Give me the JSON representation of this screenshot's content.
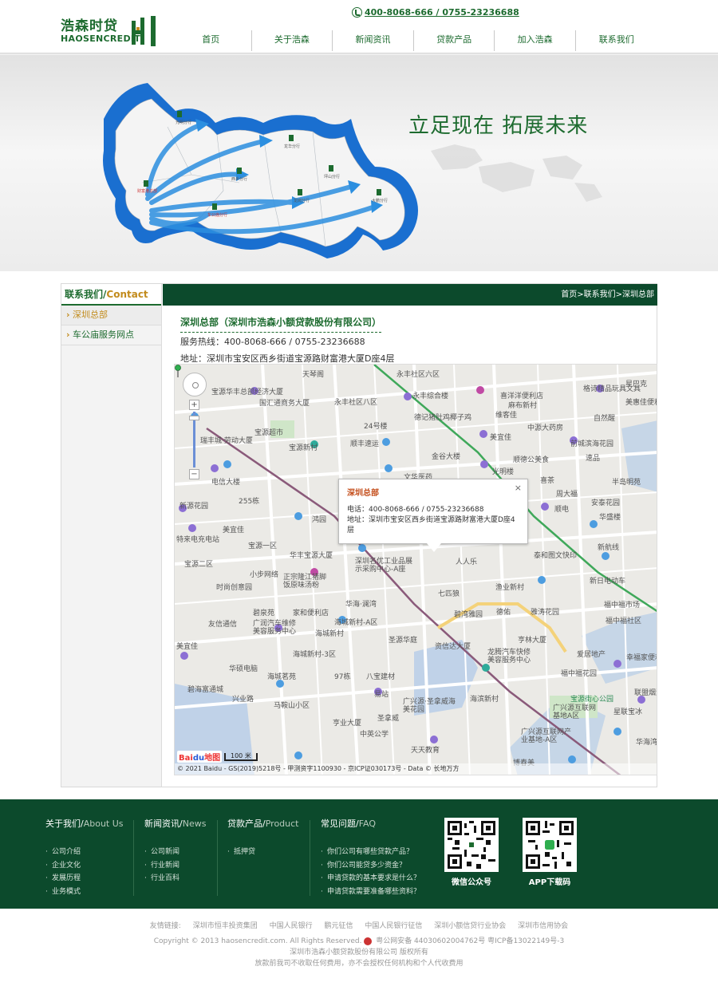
{
  "header": {
    "logo_cn": "浩森时贷",
    "logo_en": "HAOSENCREDIT",
    "hotline": "400-8068-666 / 0755-23236688",
    "nav": [
      "首页",
      "关于浩森",
      "新闻资讯",
      "贷款产品",
      "加入浩森",
      "联系我们"
    ]
  },
  "banner": {
    "slogan": "立足现在  拓展未来",
    "map_labels": [
      "财富港总部",
      "光明分行 筹备中",
      "龙华分行 筹备中",
      "龙岗分行",
      "西乡分行",
      "车公庙分行",
      "坪山分行 筹备中",
      "盐田分行 筹备中",
      "大鹏分行 筹备中"
    ]
  },
  "sidebar": {
    "title_cn": "联系我们/",
    "title_en": "Contact",
    "items": [
      "深圳总部",
      "车公庙服务网点"
    ]
  },
  "content": {
    "breadcrumb": "首页>联系我们>深圳总部",
    "office_title": "深圳总部（深圳市浩森小额贷款股份有限公司）",
    "hotline_line": "服务热线：400-8068-666 / 0755-23236688",
    "address_line": "地址：深圳市宝安区西乡街道宝源路财富港大厦D座4层"
  },
  "map": {
    "popup_title": "深圳总部",
    "popup_phone": "电话：400-8068-666 / 0755-23236688",
    "popup_address": "地址：深圳市宝安区西乡街道宝源路财富港大厦D座4层",
    "popup_close": "×",
    "zoom_in": "+",
    "zoom_out": "−",
    "scale": "100 米",
    "logo_bai": "Bai",
    "logo_du": "du",
    "logo_map": "地图",
    "copyright": "© 2021 Baidu - GS(2019)5218号 - 甲测资字1100930 - 京ICP证030173号 - Data © 长地万方",
    "labels": [
      "天琴阁",
      "宝源华丰总部经济大厦",
      "国汇通商务大厦",
      "永丰社区八区",
      "永丰社区六区",
      "永丰综合楼",
      "喜洋洋便利店",
      "格诗精品玩具文具",
      "星巴克",
      "美惠佳便利",
      "维客佳",
      "麻布新村",
      "德记猪肚鸡椰子鸡",
      "24号楼",
      "中源大药房",
      "自然醒",
      "宝源超市",
      "宝源新村",
      "顺丰速运",
      "美宜佳",
      "前城滨海花园",
      "瑞丰城·劳动大厦",
      "金谷大楼",
      "顺德公美食",
      "速品",
      "电信大楼",
      "文华医药",
      "光明楼",
      "喜茶",
      "半岛明苑",
      "新源花园",
      "255栋",
      "周大福",
      "安泰花园",
      "美宜佳",
      "鸿园",
      "顺电",
      "华盛楼",
      "特来电充电站",
      "宝源一区",
      "华丰宝源大厦",
      "深圳名优工业品展示采购中心-A座",
      "人人乐",
      "泰和图文快印",
      "新航线",
      "宝源二区",
      "小步网络",
      "正宗隆江猪脚饭原味汤粉",
      "七匹狼",
      "新日电动车",
      "时尚创意园",
      "华海·澜湾",
      "渔业新村",
      "碧泉苑",
      "家和便利店",
      "碧湾雅园",
      "德佑",
      "雅涛花园",
      "福中福市场",
      "友信通信",
      "广润汽车维修美容服务中心",
      "海城新村-A区",
      "海城新村",
      "圣源华庭",
      "福中福社区",
      "美宜佳",
      "资信达大厦",
      "亨林大厦",
      "海城新村-3区",
      "龙腾汽车快修美容服务中心",
      "爱居地产",
      "幸福家便利店",
      "华硕电脑",
      "海城茗苑",
      "八宝建材",
      "福中福花园",
      "碧海富通城",
      "97栋",
      "海滨新村",
      "易站",
      "宝源街心公园",
      "联盟烟酒",
      "马鞍山小区",
      "兴业路",
      "广兴源·圣拿威海美花园",
      "广兴源互联网基地A区",
      "星联宝冰",
      "亨业大厦",
      "圣拿威",
      "中英公学",
      "天天教育",
      "广兴源互联网产业基地-A区",
      "博春美",
      "华海湾"
    ]
  },
  "footer": {
    "cols": [
      {
        "title_cn": "关于我们/",
        "title_en": "About Us",
        "items": [
          "公司介绍",
          "企业文化",
          "发展历程",
          "业务模式"
        ]
      },
      {
        "title_cn": "新闻资讯/",
        "title_en": "News",
        "items": [
          "公司新闻",
          "行业新闻",
          "行业百科"
        ]
      },
      {
        "title_cn": "贷款产品/",
        "title_en": "Product",
        "items": [
          "抵押贷"
        ]
      },
      {
        "title_cn": "常见问题/",
        "title_en": "FAQ",
        "items": [
          "你们公司有哪些贷款产品？",
          "你们公司能贷多少资金？",
          "申请贷款的基本要求是什么？",
          "申请贷款需要准备哪些资料？"
        ]
      }
    ],
    "qr_wechat": "微信公众号",
    "qr_app": "APP下载码"
  },
  "bottom": {
    "links_label": "友情链接:",
    "links": [
      "深圳市恒丰投资集团",
      "中国人民银行",
      "鹏元征信",
      "中国人民银行征信",
      "深圳小额信贷行业协会",
      "深圳市信用协会"
    ],
    "copyright": "Copyright © 2013 haosencredit.com. All Rights Reserved.",
    "icp": "粤公网安备 44030602004762号 粤ICP备13022149号-3",
    "company": "深圳市浩森小额贷款股份有限公司 版权所有",
    "notice": "放款前我司不收取任何费用，亦不会授权任何机构和个人代收费用"
  },
  "colors": {
    "brand_green": "#1d6b2f",
    "dark_green": "#0c4a2c",
    "accent_gold": "#c28b1c",
    "map_blue": "#1a6fd0"
  }
}
